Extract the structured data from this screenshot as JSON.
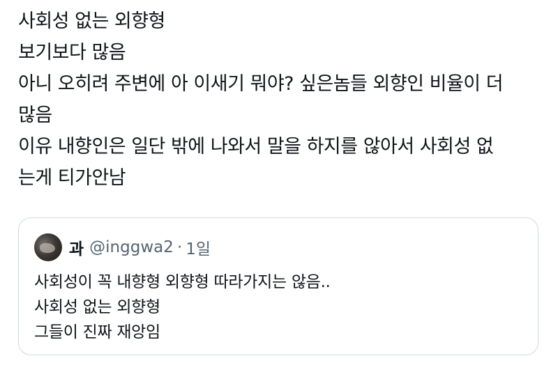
{
  "tweet": {
    "lines": [
      "사회성 없는 외향형",
      "보기보다 많음",
      "아니 오히려 주변에 아 이새기 뭐야? 싶은놈들 외향인 비율이 더",
      "많음",
      "이유 내향인은 일단 밖에 나와서 말을 하지를 않아서 사회성 없",
      "는게 티가안남"
    ]
  },
  "quote": {
    "avatar_icon": "user-avatar",
    "name": "과",
    "handle": "@inggwa2",
    "separator": "·",
    "time": "1일",
    "lines": [
      "사회성이 꼭 내향형 외향형 따라가지는 않음..",
      "사회성 없는 외향형",
      "그들이 진짜 재앙임"
    ]
  }
}
